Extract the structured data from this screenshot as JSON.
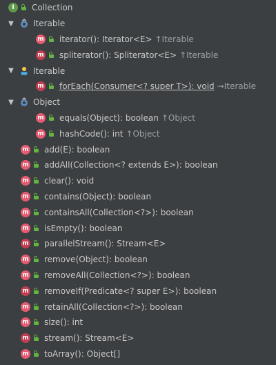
{
  "root": {
    "label": "Collection",
    "icon": "interface-icon"
  },
  "groups": [
    {
      "label": "Iterable",
      "expanded": true,
      "icon": "interface-override-icon",
      "items": [
        {
          "signature": "iterator(): Iterator<E>",
          "origin": "↑Iterable",
          "icon": "method-abstract-icon"
        },
        {
          "signature": "spliterator(): Spliterator<E>",
          "origin": "↑Iterable",
          "icon": "method-icon"
        }
      ]
    },
    {
      "label": "Iterable",
      "expanded": true,
      "icon": "person-implement-icon",
      "items": [
        {
          "signature": "forEach(Consumer<? super T>): void",
          "origin": "→Iterable",
          "icon": "method-icon",
          "underlined": true
        }
      ]
    },
    {
      "label": "Object",
      "expanded": true,
      "icon": "object-override-icon",
      "items": [
        {
          "signature": "equals(Object): boolean",
          "origin": "↑Object",
          "icon": "method-abstract-icon"
        },
        {
          "signature": "hashCode(): int",
          "origin": "↑Object",
          "icon": "method-abstract-icon"
        }
      ]
    }
  ],
  "methods": [
    "add(E): boolean",
    "addAll(Collection<? extends E>): boolean",
    "clear(): void",
    "contains(Object): boolean",
    "containsAll(Collection<?>): boolean",
    "isEmpty(): boolean",
    "parallelStream(): Stream<E>",
    "remove(Object): boolean",
    "removeAll(Collection<?>): boolean",
    "removeIf(Predicate<? super E>): boolean",
    "retainAll(Collection<?>): boolean",
    "size(): int",
    "stream(): Stream<E>",
    "toArray(): Object[]"
  ]
}
